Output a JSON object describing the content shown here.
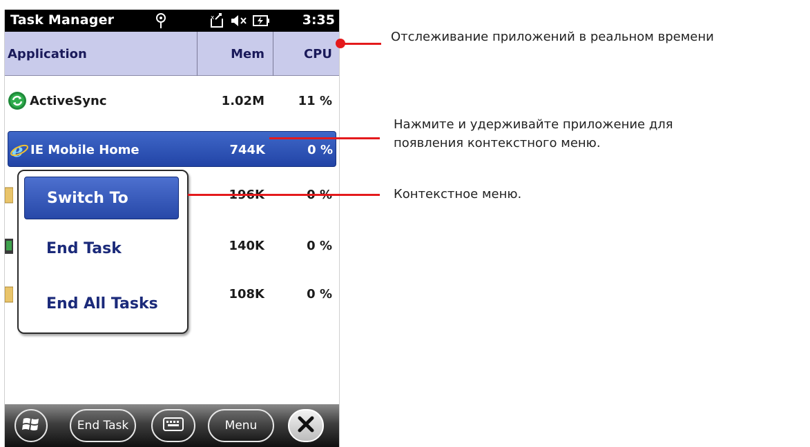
{
  "statusbar": {
    "title": "Task Manager",
    "time": "3:35",
    "icons": [
      "antenna-icon",
      "data-connection-icon",
      "volume-muted-icon",
      "battery-charging-icon"
    ]
  },
  "columns": {
    "application": "Application",
    "mem": "Mem",
    "cpu": "CPU"
  },
  "rows": [
    {
      "name": "ActiveSync",
      "mem": "1.02M",
      "cpu": "11 %",
      "icon": "activesync-icon"
    },
    {
      "name": "IE Mobile Home",
      "mem": "744K",
      "cpu": "0 %",
      "icon": "internet-explorer-icon",
      "selected": true
    },
    {
      "name": "",
      "mem": "196K",
      "cpu": "0 %",
      "icon": "folder-icon"
    },
    {
      "name": "",
      "mem": "140K",
      "cpu": "0 %",
      "icon": "monitor-icon"
    },
    {
      "name": "",
      "mem": "108K",
      "cpu": "0 %",
      "icon": "folder-icon"
    }
  ],
  "context_menu": {
    "items": [
      "Switch To",
      "End Task",
      "End All Tasks"
    ]
  },
  "toolbar": {
    "end_task": "End Task",
    "menu": "Menu",
    "icons": [
      "windows-start-icon",
      "keyboard-icon",
      "close-icon"
    ]
  },
  "annotations": {
    "realtime": "Отслеживание приложений в реальном времени",
    "press_hold_line1": "Нажмите и удерживайте приложение для",
    "press_hold_line2": "появления контекстного меню.",
    "context_menu": "Контекстное меню."
  },
  "colors": {
    "header_bg": "#c9cbeb",
    "selection": "#2f55b8",
    "callout": "#e41a1c"
  }
}
